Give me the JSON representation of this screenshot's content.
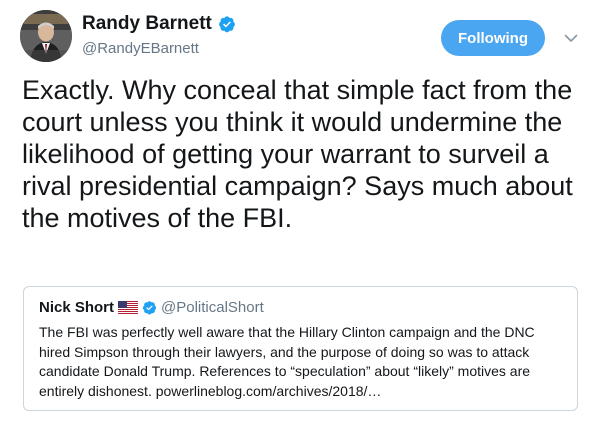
{
  "author": {
    "display_name": "Randy Barnett",
    "handle": "@RandyEBarnett",
    "verified": true,
    "avatar_icon": "person-avatar-icon"
  },
  "follow_button": {
    "label": "Following",
    "color": "#4ba6f2"
  },
  "menu": {
    "icon": "chevron-down-icon"
  },
  "tweet": {
    "text": "Exactly. Why conceal that simple fact from the court unless you think it would undermine the likelihood of getting your warrant to surveil a rival presidential campaign? Says much about the motives of the FBI."
  },
  "quoted_tweet": {
    "display_name": "Nick Short",
    "flag_icon": "us-flag-icon",
    "verified": true,
    "handle": "@PoliticalShort",
    "text": "The FBI was perfectly well aware that the Hillary Clinton campaign and the DNC hired Simpson through their lawyers, and the purpose of doing so was to attack candidate Donald Trump. References to “speculation” about “likely” motives are entirely dishonest. powerlineblog.com/archives/2018/…"
  },
  "colors": {
    "verified_blue": "#1da1f2",
    "secondary_text": "#657786",
    "border": "#ccd6dd"
  }
}
